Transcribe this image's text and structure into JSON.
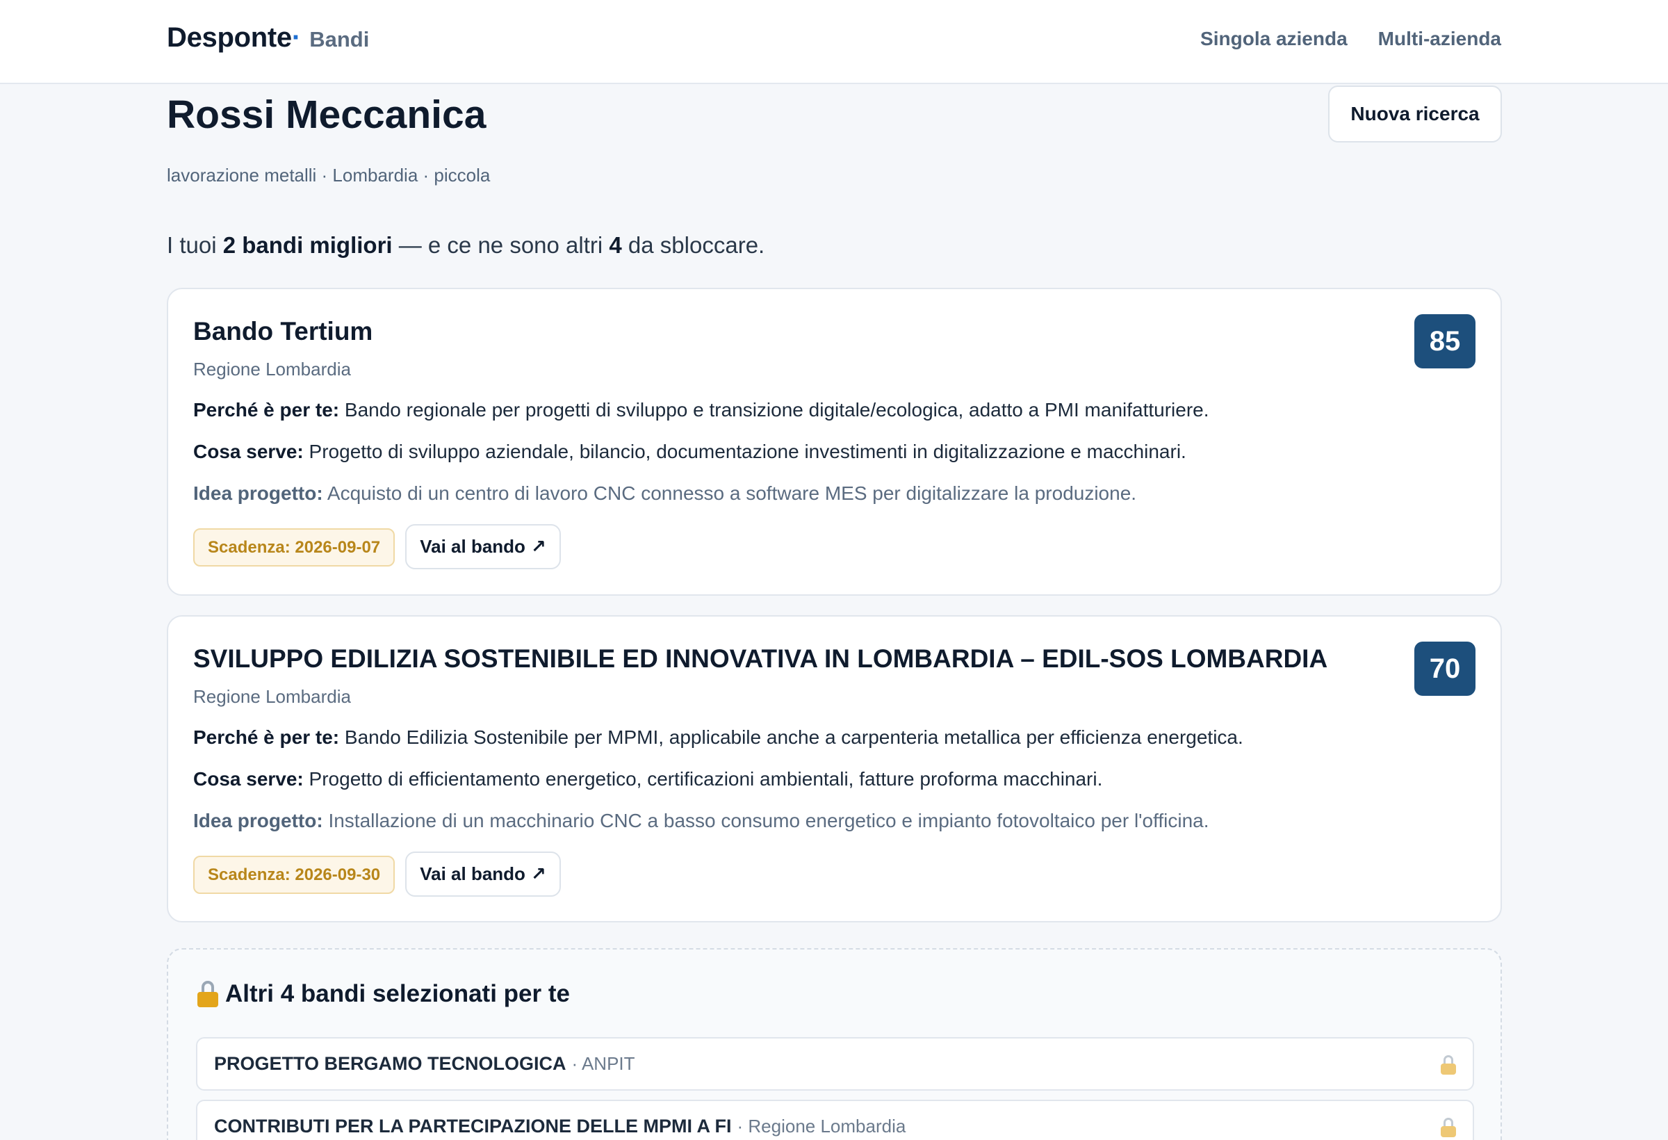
{
  "header": {
    "brand": "Desponte",
    "brand_dot": "·",
    "section": "Bandi",
    "nav": [
      "Singola azienda",
      "Multi-azienda"
    ]
  },
  "company": {
    "name": "Rossi Meccanica",
    "meta": "lavorazione metalli · Lombardia · piccola",
    "new_search": "Nuova ricerca"
  },
  "summary": {
    "prefix": "I tuoi ",
    "best": "2 bandi migliori",
    "middle": " — e ce ne sono altri ",
    "count": "4",
    "suffix": " da sbloccare."
  },
  "labels": {
    "why": "Perché è per te:",
    "needs": "Cosa serve:",
    "idea": "Idea progetto:",
    "goto": "Vai al bando",
    "goto_icon": "↗"
  },
  "bandi": [
    {
      "title": "Bando Tertium",
      "source": "Regione Lombardia",
      "score": "85",
      "why": "Bando regionale per progetti di sviluppo e transizione digitale/ecologica, adatto a PMI manifatturiere.",
      "needs": "Progetto di sviluppo aziendale, bilancio, documentazione investimenti in digitalizzazione e macchinari.",
      "idea": "Acquisto di un centro di lavoro CNC connesso a software MES per digitalizzare la produzione.",
      "deadline": "Scadenza: 2026-09-07"
    },
    {
      "title": "SVILUPPO EDILIZIA SOSTENIBILE ED INNOVATIVA IN LOMBARDIA – EDIL-SOS LOMBARDIA",
      "source": "Regione Lombardia",
      "score": "70",
      "why": "Bando Edilizia Sostenibile per MPMI, applicabile anche a carpenteria metallica per efficienza energetica.",
      "needs": "Progetto di efficientamento energetico, certificazioni ambientali, fatture proforma macchinari.",
      "idea": "Installazione di un macchinario CNC a basso consumo energetico e impianto fotovoltaico per l'officina.",
      "deadline": "Scadenza: 2026-09-30"
    }
  ],
  "locked": {
    "title": "Altri 4 bandi selezionati per te",
    "items": [
      {
        "name": "PROGETTO BERGAMO TECNOLOGICA",
        "source": "· ANPIT"
      },
      {
        "name": "CONTRIBUTI PER LA PARTECIPAZIONE DELLE MPMI A FI",
        "source": "· Regione Lombardia"
      }
    ]
  },
  "colors": {
    "accent": "#1f6fd1",
    "score_bg": "#1d4f7c",
    "deadline_text": "#b8861a",
    "deadline_bg": "#fdf6e8"
  }
}
